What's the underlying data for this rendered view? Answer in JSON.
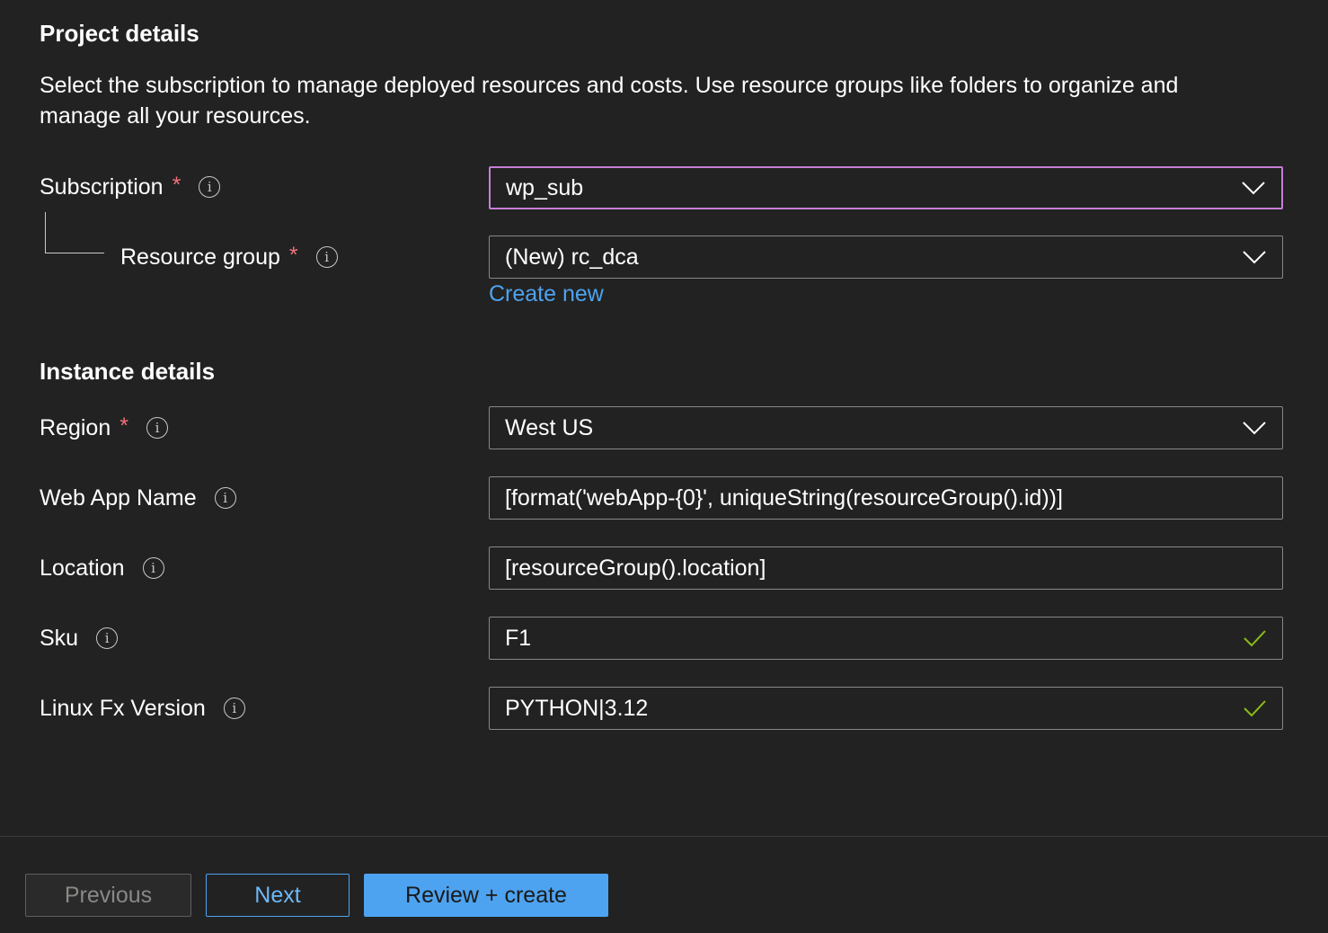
{
  "project": {
    "title": "Project details",
    "description": "Select the subscription to manage deployed resources and costs. Use resource groups like folders to organize and manage all your resources."
  },
  "subscription": {
    "label": "Subscription",
    "required": "*",
    "value": "wp_sub",
    "icon": "chevron-down-icon"
  },
  "resource_group": {
    "label": "Resource group",
    "required": "*",
    "value": "(New) rc_dca",
    "create_new": "Create new",
    "icon": "chevron-down-icon"
  },
  "instance": {
    "title": "Instance details"
  },
  "region": {
    "label": "Region",
    "required": "*",
    "value": "West US",
    "icon": "chevron-down-icon"
  },
  "web_app_name": {
    "label": "Web App Name",
    "value": "[format('webApp-{0}', uniqueString(resourceGroup().id))]"
  },
  "location": {
    "label": "Location",
    "value": "[resourceGroup().location]"
  },
  "sku": {
    "label": "Sku",
    "value": "F1",
    "status_icon": "checkmark-icon"
  },
  "linux_fx": {
    "label": "Linux Fx Version",
    "value": "PYTHON|3.12",
    "status_icon": "checkmark-icon"
  },
  "info_icon": "i",
  "footer": {
    "previous": "Previous",
    "next": "Next",
    "review_create": "Review + create"
  },
  "colors": {
    "background": "#222222",
    "accent": "#4da3f0",
    "focus_border": "#c77dd6",
    "required": "#f1707b",
    "valid": "#8cbd18"
  }
}
